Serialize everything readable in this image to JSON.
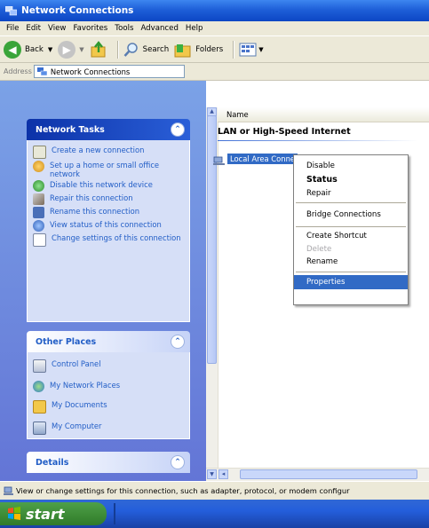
{
  "window": {
    "title": "Network Connections"
  },
  "menu": [
    "File",
    "Edit",
    "View",
    "Favorites",
    "Tools",
    "Advanced",
    "Help"
  ],
  "toolbar": {
    "back_label": "Back",
    "search_label": "Search",
    "folders_label": "Folders"
  },
  "address": {
    "label": "Address",
    "value": "Network Connections"
  },
  "network_tasks": {
    "title": "Network Tasks",
    "items": [
      "Create a new connection",
      "Set up a home or small office network",
      "Disable this network device",
      "Repair this connection",
      "Rename this connection",
      "View status of this connection",
      "Change settings of this connection"
    ]
  },
  "other_places": {
    "title": "Other Places",
    "items": [
      "Control Panel",
      "My Network Places",
      "My Documents",
      "My Computer"
    ]
  },
  "details": {
    "title": "Details"
  },
  "list": {
    "column_name": "Name",
    "group_heading": "LAN or High-Speed Internet",
    "item_label": "Local Area Connection"
  },
  "context_menu": {
    "items": [
      "Disable",
      "Status",
      "Repair",
      "Bridge Connections",
      "Create Shortcut",
      "Delete",
      "Rename",
      "Properties"
    ]
  },
  "status_bar": {
    "text": "View or change settings for this connection, such as adapter, protocol, or modem configur"
  },
  "taskbar": {
    "start_label": "start"
  },
  "colors": {
    "xp_blue": "#245edb",
    "selection": "#316ac5",
    "start_green": "#3c8a35"
  }
}
